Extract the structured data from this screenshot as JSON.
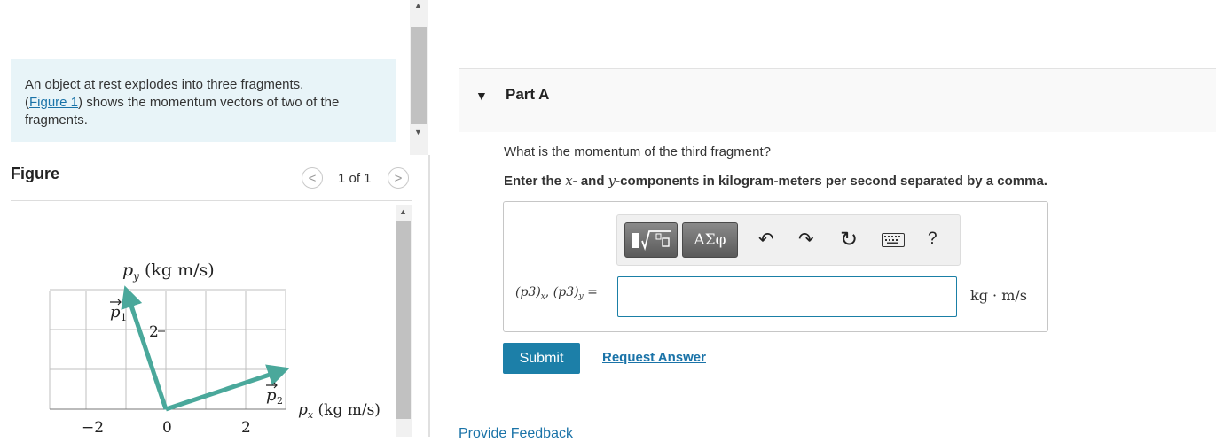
{
  "problem": {
    "text_before_link": "An object at rest explodes into three fragments.",
    "link_open": "(",
    "link_text": "Figure 1",
    "link_close": ")",
    "text_after_link": " shows the momentum vectors of two of the fragments."
  },
  "figure_panel": {
    "title": "Figure",
    "counter": "1 of 1",
    "prev_icon": "chevron-left-icon",
    "next_icon": "chevron-right-icon"
  },
  "figure": {
    "y_axis_label": "p",
    "y_axis_sub": "y",
    "y_axis_unit": " (kg m/s)",
    "x_axis_label": "p",
    "x_axis_sub": "x",
    "x_axis_unit": " (kg m/s)",
    "x_ticks": [
      "−2",
      "0",
      "2"
    ],
    "y_tick": "2",
    "vector1_label": "p",
    "vector1_sub": "1",
    "vector2_label": "p",
    "vector2_sub": "2",
    "vectors": [
      {
        "name": "p1",
        "x": -1,
        "y": 3
      },
      {
        "name": "p2",
        "x": 3,
        "y": 1
      }
    ],
    "vector_color": "#4aa89b",
    "grid_color": "#bfbfbf"
  },
  "part": {
    "caret": "▼",
    "title": "Part A",
    "question": "What is the momentum of the third fragment?",
    "instruction_pre": "Enter the ",
    "instruction_x": "x",
    "instruction_mid": "- and ",
    "instruction_y": "y",
    "instruction_post": "-components in kilogram-meters per second separated by a comma."
  },
  "toolbar": {
    "templates_icon": "templates-icon",
    "symbols_label": "ΑΣφ",
    "undo_icon": "undo-icon",
    "redo_icon": "redo-icon",
    "reset_icon": "reset-icon",
    "keyboard_icon": "keyboard-icon",
    "help_label": "?"
  },
  "answer": {
    "label_p1": "(p3)",
    "label_sub1": "x",
    "label_sep": ", ",
    "label_p2": "(p3)",
    "label_sub2": "y",
    "label_eq": " =",
    "value": "",
    "unit": "kg · m/s"
  },
  "actions": {
    "submit": "Submit",
    "request_answer": "Request Answer",
    "provide_feedback": "Provide Feedback"
  },
  "colors": {
    "accent": "#1c7fa8",
    "link": "#1a73a8",
    "problem_bg": "#e8f4f8"
  }
}
